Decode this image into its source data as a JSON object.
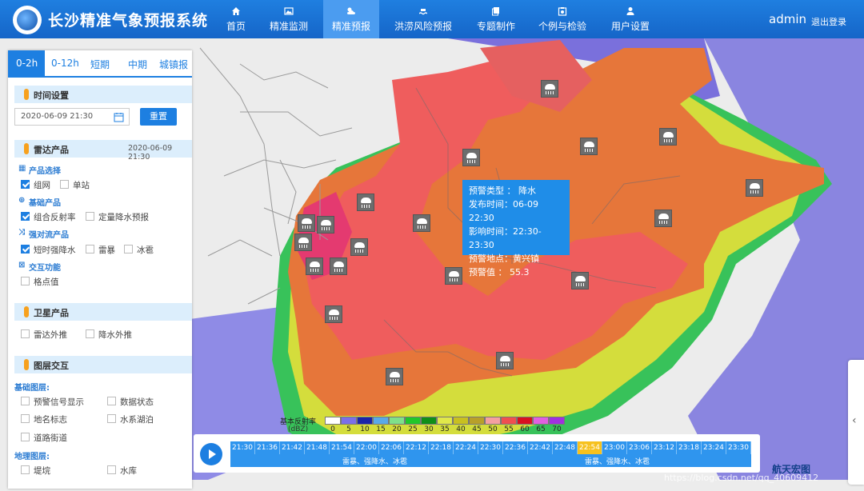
{
  "header": {
    "title": "长沙精准气象预报系统",
    "nav": [
      {
        "label": "首页",
        "icon": "home-icon"
      },
      {
        "label": "精准监测",
        "icon": "monitor-image-icon"
      },
      {
        "label": "精准预报",
        "icon": "weather-cloud-icon",
        "active": true
      },
      {
        "label": "洪涝风险预报",
        "icon": "flood-icon"
      },
      {
        "label": "专题制作",
        "icon": "document-copy-icon"
      },
      {
        "label": "个例与检验",
        "icon": "case-icon"
      },
      {
        "label": "用户设置",
        "icon": "user-icon"
      }
    ],
    "user": "admin",
    "logout": "退出登录"
  },
  "panel": {
    "tabs": [
      "0-2h",
      "0-12h",
      "短期",
      "中期",
      "城镇报"
    ],
    "active_tab": "0-2h",
    "time_settings": {
      "title": "时间设置",
      "datetime_value": "2020-06-09 21:30",
      "reset_label": "重置"
    },
    "radar": {
      "title": "雷达产品",
      "datetime": "2020-06-09 21:30",
      "product_select": "产品选择",
      "opt_network": "组网",
      "opt_single": "单站",
      "basic_products": "基础产品",
      "opt_composite": "组合反射率",
      "opt_qpf": "定量降水预报",
      "convection": "强对流产品",
      "opt_short_rain": "短时强降水",
      "opt_thunder": "雷暴",
      "opt_hail": "冰雹",
      "interaction": "交互功能",
      "opt_grid": "格点值"
    },
    "satellite": {
      "title": "卫星产品",
      "opt_radar_extrap": "雷达外推",
      "opt_rain_extrap": "降水外推"
    },
    "layers": {
      "title": "图层交互",
      "basic_layers": "基础图层:",
      "opt_signal": "预警信号显示",
      "opt_data_status": "数据状态",
      "opt_place": "地名标志",
      "opt_water": "水系湖泊",
      "opt_road": "道路街道",
      "geo_layers": "地理图层:",
      "opt_dyke": "堤垸",
      "opt_reservoir": "水库"
    }
  },
  "popup": {
    "type": "预警类型 ： 降水",
    "issue": "发布时间：06-09 22:30",
    "effect": "影响时间：22:30-23:30",
    "place": "预警地点：黄兴镇",
    "value": "预警值 ： 55.3"
  },
  "legend": {
    "title": "基本反射率",
    "unit": "(dBZ)",
    "items": [
      {
        "label": "0",
        "color": "#ffffff"
      },
      {
        "label": "5",
        "color": "#7b6fe8"
      },
      {
        "label": "10",
        "color": "#1b24a8"
      },
      {
        "label": "15",
        "color": "#5aa9e8"
      },
      {
        "label": "20",
        "color": "#7fe08a"
      },
      {
        "label": "25",
        "color": "#20c82a"
      },
      {
        "label": "30",
        "color": "#0f8f18"
      },
      {
        "label": "35",
        "color": "#e0e84a"
      },
      {
        "label": "40",
        "color": "#c8c020"
      },
      {
        "label": "45",
        "color": "#b8a02a"
      },
      {
        "label": "50",
        "color": "#f4a0a0"
      },
      {
        "label": "55",
        "color": "#ef5050"
      },
      {
        "label": "60",
        "color": "#d81020"
      },
      {
        "label": "65",
        "color": "#e060e0"
      },
      {
        "label": "70",
        "color": "#a030e0"
      }
    ]
  },
  "timeline": {
    "ticks": [
      "21:30",
      "21:36",
      "21:42",
      "21:48",
      "21:54",
      "22:00",
      "22:06",
      "22:12",
      "22:18",
      "22:24",
      "22:30",
      "22:36",
      "22:42",
      "22:48",
      "22:54",
      "23:00",
      "23:06",
      "23:12",
      "23:18",
      "23:24",
      "23:30"
    ],
    "selected": "22:54",
    "row_label_1": "雷暴、强降水、冰雹",
    "row_label_2": "雷暴、强降水、冰雹"
  },
  "brand": "航天宏图",
  "watermark": "https://blog.csdn.net/qq_40609412"
}
